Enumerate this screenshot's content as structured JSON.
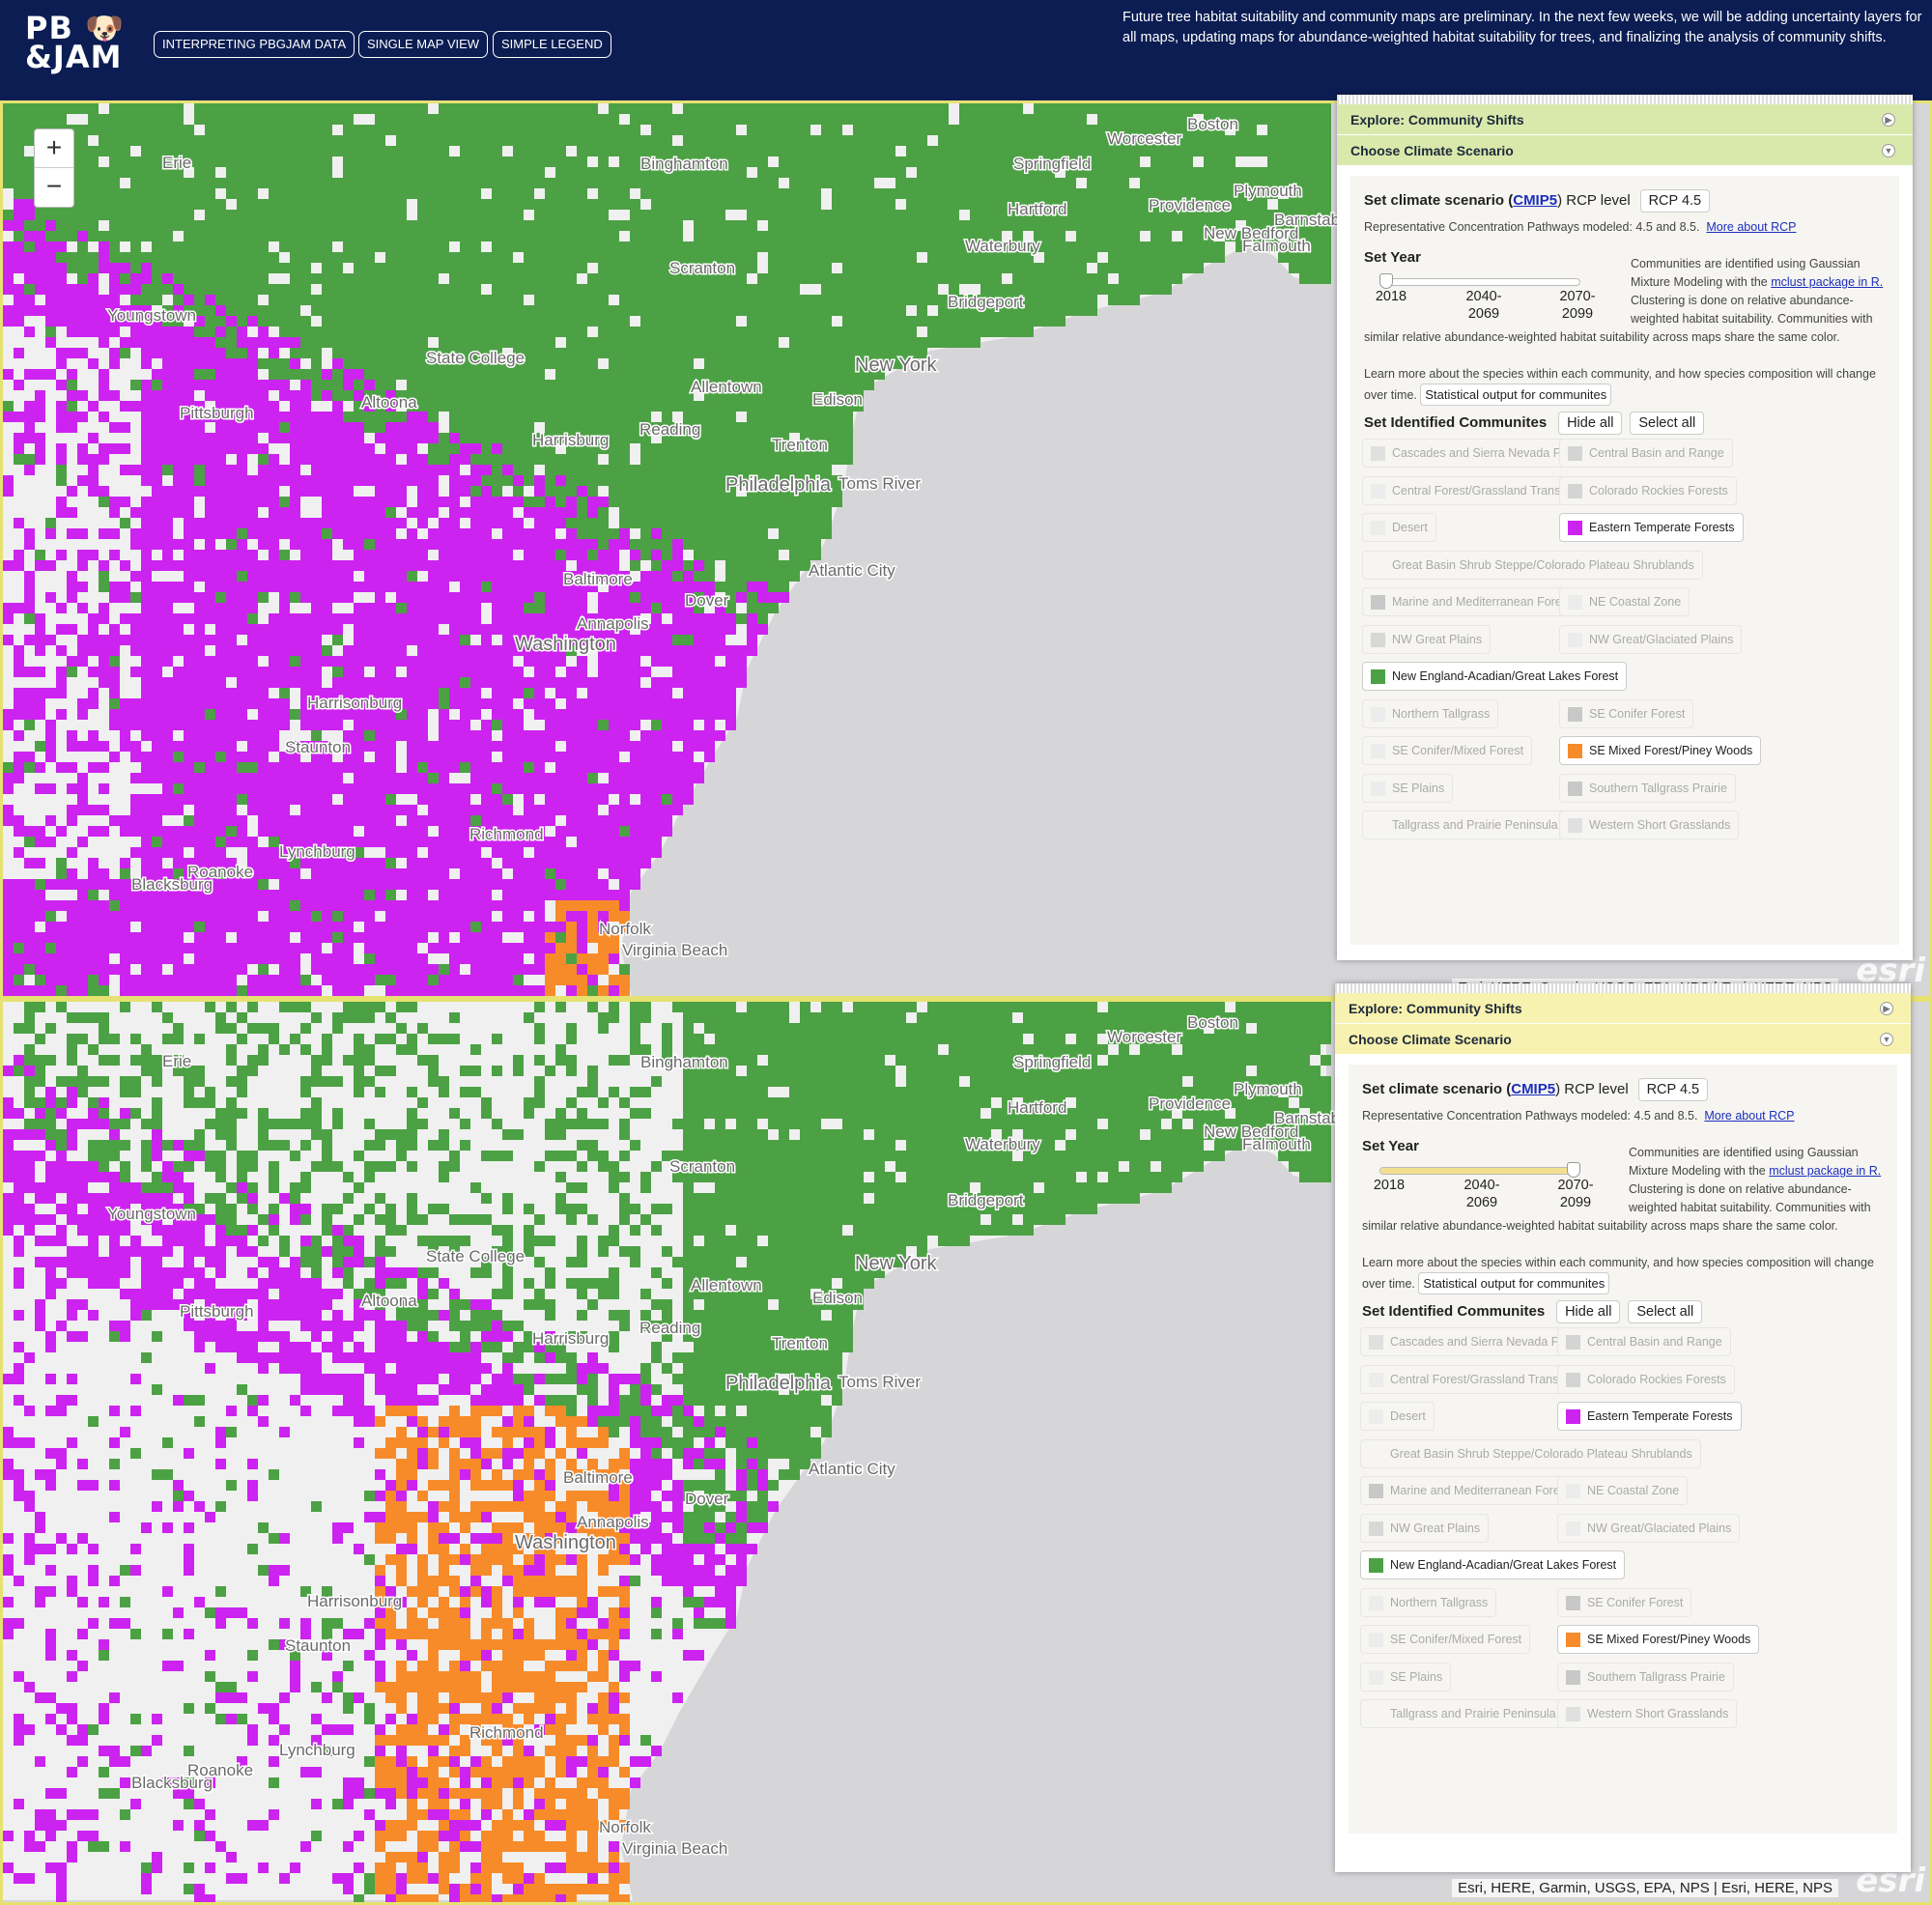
{
  "header": {
    "logo_line1": "PB 🐶",
    "logo_line2": "&JAM",
    "buttons": [
      "INTERPRETING PBGJAM DATA",
      "SINGLE MAP VIEW",
      "SIMPLE LEGEND"
    ],
    "notice": "Future tree habitat suitability and community maps are preliminary. In the next few weeks, we will be adding uncertainty layers for all maps, updating maps for abundance-weighted habitat suitability for trees, and finalizing the analysis of community shifts."
  },
  "colors": {
    "eastern_temperate": "#cc23f0",
    "new_england": "#4ca144",
    "se_mixed": "#f78b2a",
    "ocean": "#d6d6d9",
    "land": "#f0f0f0",
    "panel_top_bar": "#d9e9ac",
    "panel_bottom_bar": "#f8f2b0"
  },
  "cities": [
    "Erie",
    "Binghamton",
    "Worcester",
    "Boston",
    "Springfield",
    "Plymouth",
    "Hartford",
    "Providence",
    "Barnstable",
    "New Bedford",
    "Falmouth",
    "Waterbury",
    "Scranton",
    "Bridgeport",
    "Youngstown",
    "State College",
    "New York",
    "Allentown",
    "Edison",
    "Pittsburgh",
    "Altoona",
    "Harrisburg",
    "Reading",
    "Trenton",
    "Philadelphia",
    "Toms River",
    "Baltimore",
    "Atlantic City",
    "Dover",
    "Annapolis",
    "Washington",
    "Harrisonburg",
    "Staunton",
    "Richmond",
    "Lynchburg",
    "Roanoke",
    "Blacksburg",
    "Norfolk",
    "Virginia Beach"
  ],
  "map_chrome": {
    "zoom_in": "+",
    "zoom_out": "−",
    "attribution": "Esri, HERE, Garmin, USGS, EPA, NPS | Esri, HERE, NPS",
    "esri_logo": "esri"
  },
  "panel": {
    "explore_label": "Explore: Community Shifts",
    "scenario_label": "Choose Climate Scenario",
    "set_scenario_pre": "Set climate scenario (",
    "cmip_link": "CMIP5",
    "set_scenario_post": ") RCP level",
    "rcp_value": "RCP 4.5",
    "rcp_note": "Representative Concentration Pathways modeled: 4.5 and 8.5.",
    "more_rcp_link": "More about RCP",
    "set_year_label": "Set Year",
    "year_ticks": [
      "2018",
      "2040-\n2069",
      "2070-\n2099"
    ],
    "gmm_text_1": "Communities are identified using Gaussian Mixture Modeling with the ",
    "gmm_link": "mclust package in R.",
    "gmm_text_2": " Clustering is done on relative abundance-weighted habitat suitability. Communities with similar relative abundance-weighted habitat suitability across maps share the same color.",
    "learn_more_text": "Learn more about the species within each community, and how species composition will change over time.",
    "stat_button": "Statistical output for communites",
    "set_communities_label": "Set Identified Communites",
    "hide_all": "Hide all",
    "select_all": "Select all",
    "communities": [
      {
        "name": "Cascades and Sierra Nevada Forest",
        "on": false,
        "swatch": "#e0e0e0"
      },
      {
        "name": "Central Basin and Range",
        "on": false,
        "swatch": "#d4d4d4"
      },
      {
        "name": "Central Forest/Grassland Transition",
        "on": false,
        "swatch": "#ececec"
      },
      {
        "name": "Colorado Rockies Forests",
        "on": false,
        "swatch": "#d4d4d4"
      },
      {
        "name": "Desert",
        "on": false,
        "swatch": "#ececec"
      },
      {
        "name": "Eastern Temperate Forests",
        "on": true,
        "swatch": "#cc23f0"
      },
      {
        "name": "Great Basin Shrub Steppe/Colorado Plateau Shrublands",
        "on": false,
        "swatch": null
      },
      {
        "name": "Marine and Mediterranean Forests",
        "on": false,
        "swatch": "#c8c8c8"
      },
      {
        "name": "NE Coastal Zone",
        "on": false,
        "swatch": "#ececec"
      },
      {
        "name": "NW Great Plains",
        "on": false,
        "swatch": "#d8d8d8"
      },
      {
        "name": "NW Great/Glaciated Plains",
        "on": false,
        "swatch": "#ececec"
      },
      {
        "name": "New England-Acadian/Great Lakes Forest",
        "on": true,
        "swatch": "#4ca144"
      },
      {
        "name": "Northern Tallgrass",
        "on": false,
        "swatch": "#ececec"
      },
      {
        "name": "SE Conifer Forest",
        "on": false,
        "swatch": "#c8c8c8"
      },
      {
        "name": "SE Conifer/Mixed Forest",
        "on": false,
        "swatch": "#ececec"
      },
      {
        "name": "SE Mixed Forest/Piney Woods",
        "on": true,
        "swatch": "#f78b2a"
      },
      {
        "name": "SE Plains",
        "on": false,
        "swatch": "#ececec"
      },
      {
        "name": "Southern Tallgrass Prairie",
        "on": false,
        "swatch": "#c8c8c8"
      },
      {
        "name": "Tallgrass and Prairie Peninsula",
        "on": false,
        "swatch": null
      },
      {
        "name": "Western Short Grasslands",
        "on": false,
        "swatch": "#e0e0e0"
      }
    ]
  },
  "maps": [
    {
      "year_fraction": 0.0
    },
    {
      "year_fraction": 1.0
    }
  ]
}
